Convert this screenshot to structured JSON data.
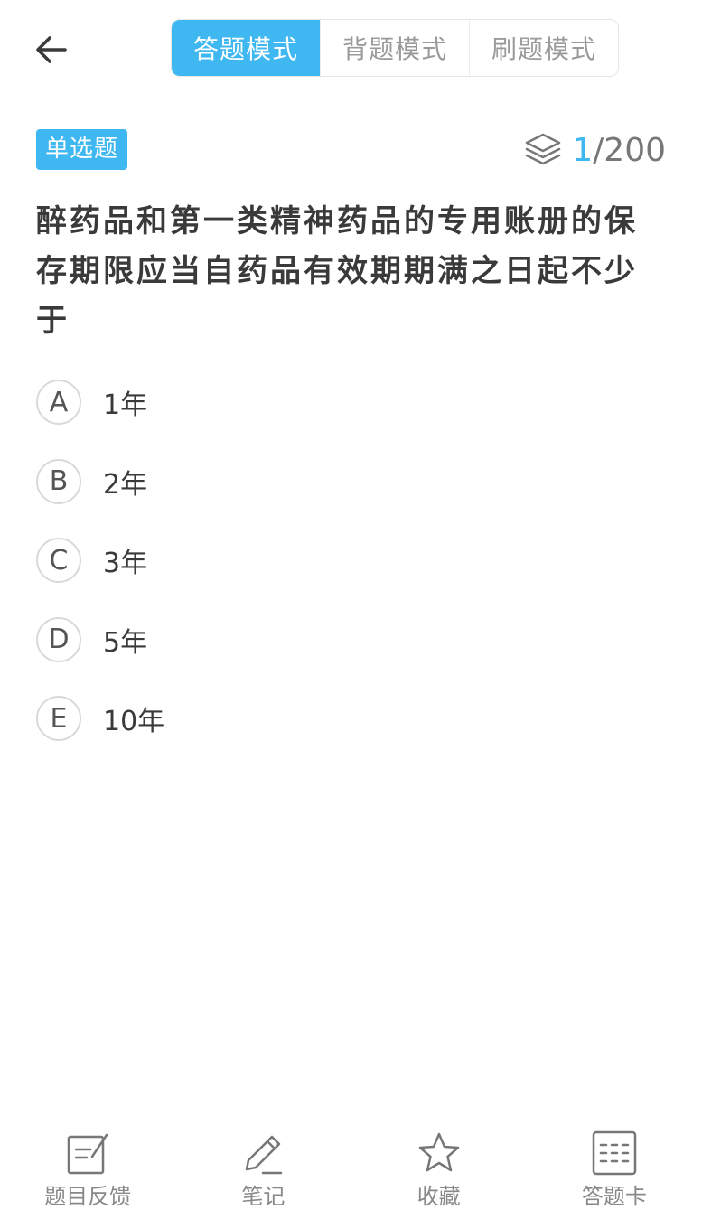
{
  "header": {
    "back_icon": "arrow-left-icon",
    "mode_tabs": [
      {
        "label": "答题模式",
        "active": true
      },
      {
        "label": "背题模式",
        "active": false
      },
      {
        "label": "刷题模式",
        "active": false
      }
    ]
  },
  "question": {
    "type_label": "单选题",
    "progress_current": "1",
    "progress_total": "/200",
    "progress_icon": "layers-icon",
    "text": "醉药品和第一类精神药品的专用账册的保存期限应当自药品有效期期满之日起不少于",
    "options": [
      {
        "letter": "A",
        "text": "1年"
      },
      {
        "letter": "B",
        "text": "2年"
      },
      {
        "letter": "C",
        "text": "3年"
      },
      {
        "letter": "D",
        "text": "5年"
      },
      {
        "letter": "E",
        "text": "10年"
      }
    ]
  },
  "bottom_bar": {
    "items": [
      {
        "label": "题目反馈",
        "icon": "feedback-edit-icon"
      },
      {
        "label": "笔记",
        "icon": "pencil-icon"
      },
      {
        "label": "收藏",
        "icon": "star-icon"
      },
      {
        "label": "答题卡",
        "icon": "answer-card-icon"
      }
    ]
  },
  "colors": {
    "accent": "#3fb7f0",
    "text": "#3a3a3a",
    "muted": "#9a9a9a"
  }
}
